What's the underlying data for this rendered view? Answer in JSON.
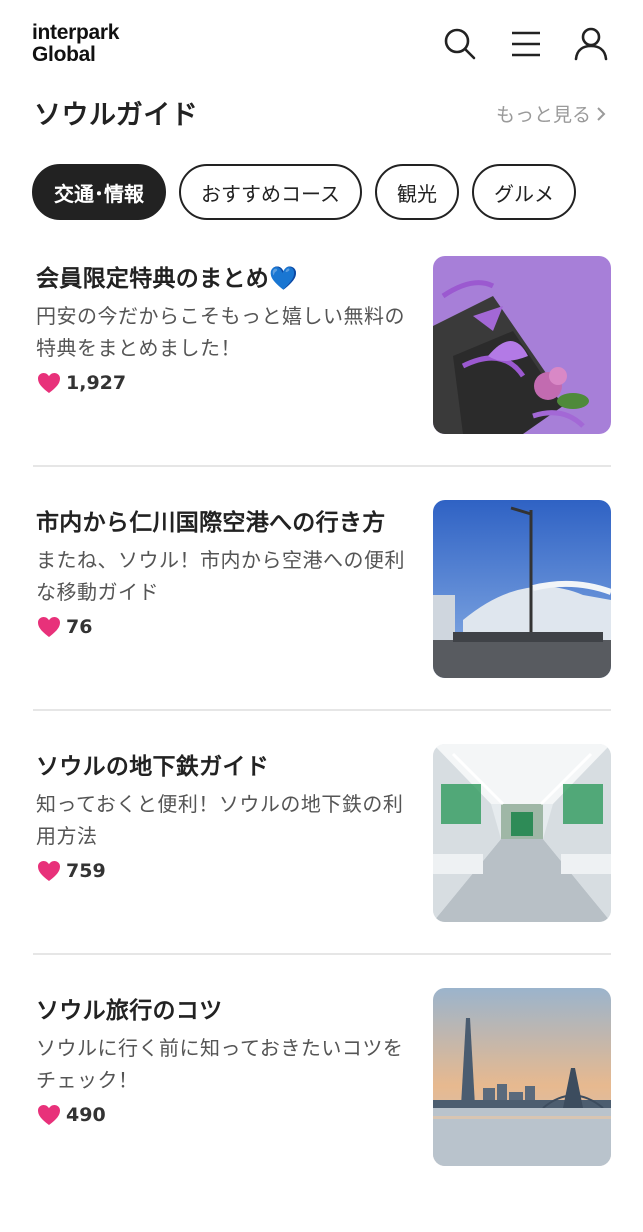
{
  "brand": {
    "line1": "interpark",
    "line2": "Global"
  },
  "header": {
    "icons": [
      "search-icon",
      "menu-icon",
      "user-icon"
    ]
  },
  "section": {
    "title": "ソウルガイド",
    "more_label": "もっと見る"
  },
  "chips": [
    {
      "label": "交通･情報",
      "active": true
    },
    {
      "label": "おすすめコース",
      "active": false
    },
    {
      "label": "観光",
      "active": false
    },
    {
      "label": "グルメ",
      "active": false
    }
  ],
  "articles": [
    {
      "title": "会員限定特典のまとめ💙",
      "desc": "円安の今だからこそもっと嬉しい無料の特典をまとめました！",
      "likes": "1,927",
      "image": "gift-boxes"
    },
    {
      "title": "市内から仁川国際空港への行き方",
      "desc": "またね、ソウル！市内から空港への便利な移動ガイド",
      "likes": "76",
      "image": "airport-terminal"
    },
    {
      "title": "ソウルの地下鉄ガイド",
      "desc": "知っておくと便利！ソウルの地下鉄の利用方法",
      "likes": "759",
      "image": "subway-interior"
    },
    {
      "title": "ソウル旅行のコツ",
      "desc": "ソウルに行く前に知っておきたいコツをチェック！",
      "likes": "490",
      "image": "seoul-skyline"
    }
  ],
  "colors": {
    "heart": "#e8317a",
    "chip_active_bg": "#222222",
    "divider": "#e6e6e6"
  }
}
